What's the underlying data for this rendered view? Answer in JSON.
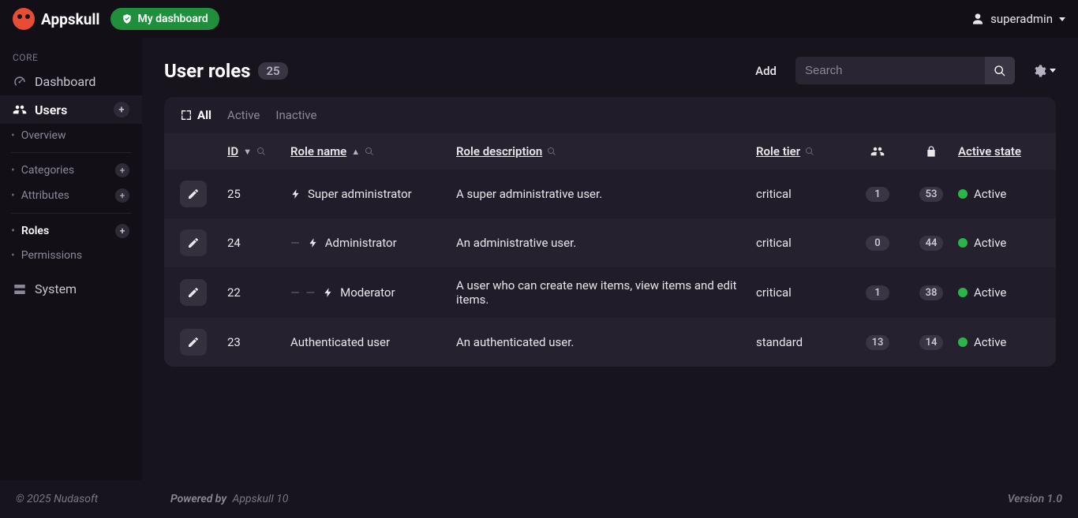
{
  "brand": {
    "name": "Appskull"
  },
  "topbar": {
    "my_dashboard": "My dashboard",
    "user": "superadmin"
  },
  "sidebar": {
    "section_core": "CORE",
    "dashboard": "Dashboard",
    "users": "Users",
    "overview": "Overview",
    "categories": "Categories",
    "attributes": "Attributes",
    "roles": "Roles",
    "permissions": "Permissions",
    "system": "System"
  },
  "page": {
    "title": "User roles",
    "count": "25",
    "add": "Add",
    "search_placeholder": "Search"
  },
  "tabs": {
    "all": "All",
    "active": "Active",
    "inactive": "Inactive"
  },
  "columns": {
    "id": "ID",
    "role_name": "Role name",
    "role_description": "Role description",
    "role_tier": "Role tier",
    "active_state": "Active state"
  },
  "rows": [
    {
      "id": "25",
      "indent": 0,
      "bolt": true,
      "name": "Super administrator",
      "desc": "A super administrative user.",
      "tier": "critical",
      "users": "1",
      "perms": "53",
      "state": "Active"
    },
    {
      "id": "24",
      "indent": 1,
      "bolt": true,
      "name": "Administrator",
      "desc": "An administrative user.",
      "tier": "critical",
      "users": "0",
      "perms": "44",
      "state": "Active"
    },
    {
      "id": "22",
      "indent": 2,
      "bolt": true,
      "name": "Moderator",
      "desc": "A user who can create new items, view items and edit items.",
      "tier": "critical",
      "users": "1",
      "perms": "38",
      "state": "Active"
    },
    {
      "id": "23",
      "indent": 0,
      "bolt": false,
      "name": "Authenticated user",
      "desc": "An authenticated user.",
      "tier": "standard",
      "users": "13",
      "perms": "14",
      "state": "Active"
    }
  ],
  "footer": {
    "copyright": "© 2025 Nudasoft",
    "powered_by_label": "Powered by",
    "powered_by": "Appskull 10",
    "version": "Version 1.0"
  }
}
